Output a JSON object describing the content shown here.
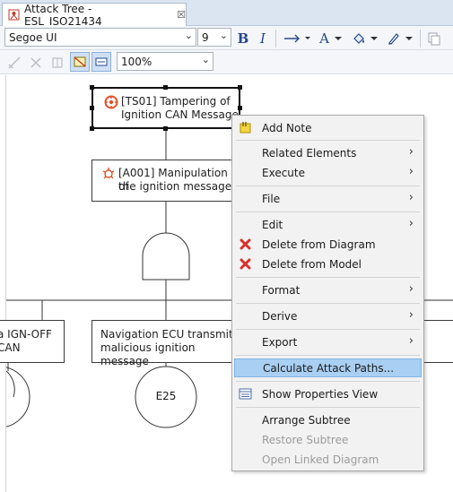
{
  "editor": {
    "tab_title": "Attack Tree - ESL_ISO21434",
    "tab_close": "☒"
  },
  "toolbar": {
    "font_name": "Segoe UI",
    "font_size": "9",
    "bold": "B",
    "italic": "I",
    "font_color_letter": "A",
    "zoom": "100%"
  },
  "diagram": {
    "threat": {
      "id": "[TS01]",
      "text_line1": "[TS01] Tampering of",
      "text_line2": "Ignition CAN Message"
    },
    "attack": {
      "text_line1": "[A001] Manipulation of",
      "text_line2": "the ignition message"
    },
    "left_step": {
      "text_line1": "a IGN-OFF",
      "text_line2": "CAN"
    },
    "nav_step": {
      "text_line1": "Navigation ECU transmits",
      "text_line2": "malicious ignition message"
    },
    "event": {
      "label": "E25"
    }
  },
  "context_menu": {
    "items": [
      {
        "label": "Add Note",
        "icon": "note-icon",
        "submenu": false,
        "enabled": true
      },
      {
        "label": "Related Elements",
        "submenu": true,
        "enabled": true
      },
      {
        "label": "Execute",
        "submenu": true,
        "enabled": true
      },
      {
        "label": "File",
        "submenu": true,
        "enabled": true
      },
      {
        "label": "Edit",
        "submenu": true,
        "enabled": true
      },
      {
        "label": "Delete from Diagram",
        "icon": "delete-icon",
        "submenu": false,
        "enabled": true
      },
      {
        "label": "Delete from Model",
        "icon": "delete-icon",
        "submenu": false,
        "enabled": true
      },
      {
        "label": "Format",
        "submenu": true,
        "enabled": true
      },
      {
        "label": "Derive",
        "submenu": true,
        "enabled": true
      },
      {
        "label": "Export",
        "submenu": true,
        "enabled": true
      },
      {
        "label": "Calculate Attack Paths...",
        "submenu": false,
        "enabled": true,
        "highlighted": true
      },
      {
        "label": "Show Properties View",
        "icon": "properties-icon",
        "submenu": false,
        "enabled": true
      },
      {
        "label": "Arrange Subtree",
        "submenu": false,
        "enabled": true
      },
      {
        "label": "Restore Subtree",
        "submenu": false,
        "enabled": false
      },
      {
        "label": "Open Linked Diagram",
        "submenu": false,
        "enabled": false
      }
    ],
    "submenu_arrow": "›"
  },
  "colors": {
    "accent": "#244a8c",
    "menu_highlight": "#a9cff2",
    "delete_red": "#d9302b",
    "threat_icon": "#e0532a"
  }
}
